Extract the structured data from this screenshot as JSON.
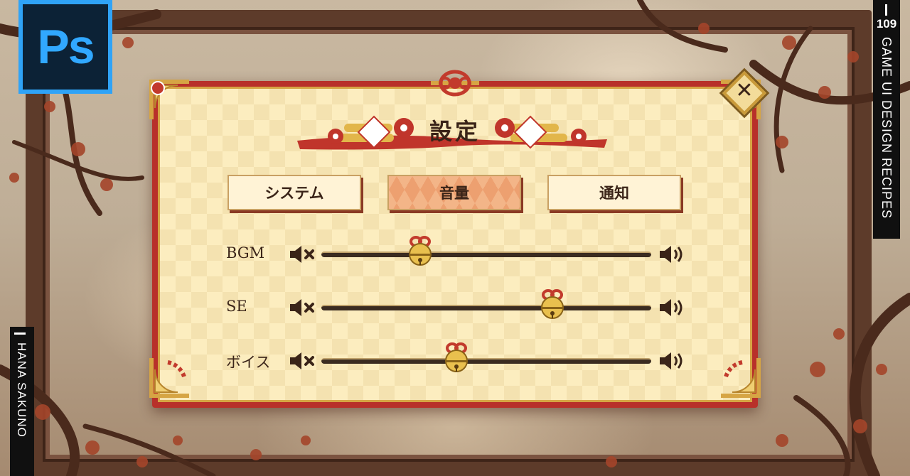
{
  "brand": {
    "ps_badge": "Ps",
    "series_number": "109",
    "series_title": "GAME UI DESIGN RECIPES",
    "author": "HANA SAKUNO"
  },
  "dialog": {
    "title": "設定",
    "close_icon": "close-x-icon"
  },
  "tabs": [
    {
      "label": "システム",
      "active": false
    },
    {
      "label": "音量",
      "active": true
    },
    {
      "label": "通知",
      "active": false
    }
  ],
  "sliders": [
    {
      "label": "BGM",
      "value": 0.3
    },
    {
      "label": "SE",
      "value": 0.7
    },
    {
      "label": "ボイス",
      "value": 0.41
    }
  ],
  "icons": {
    "mute": "speaker-mute-icon",
    "volume": "speaker-volume-icon",
    "handle": "bell-handle-icon"
  },
  "colors": {
    "frame_red": "#b8302a",
    "gold": "#d6a544",
    "panel_cream": "#fcedbf",
    "active_tab": "#eda070",
    "ink": "#3a2418"
  }
}
